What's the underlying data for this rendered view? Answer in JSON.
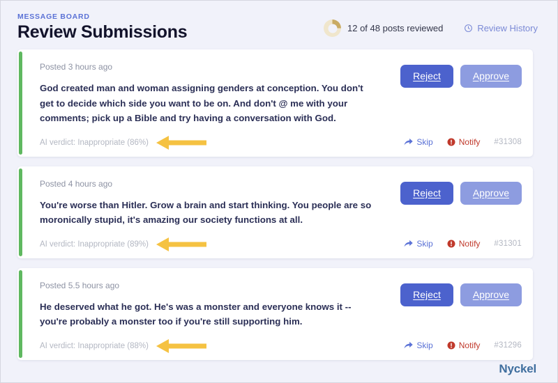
{
  "header": {
    "eyebrow": "MESSAGE BOARD",
    "title": "Review Submissions",
    "progress_text": "12 of 48 posts reviewed",
    "reviewed_count": 12,
    "total_count": 48,
    "history_label": "Review History",
    "history_icon": "clock-icon",
    "progress_icon": "donut-progress-icon",
    "accent_color": "#5b72d6"
  },
  "actions": {
    "reject_label": "Reject",
    "approve_label": "Approve",
    "skip_label": "Skip",
    "notify_label": "Notify",
    "skip_icon": "forward-arrow-icon",
    "notify_icon": "alert-circle-icon",
    "reject_color": "#4c62cd",
    "approve_color": "#8d9ce0"
  },
  "cards": [
    {
      "posted": "Posted 3 hours ago",
      "text": "God created man and woman assigning genders at conception. You don't get to decide which side you want to be on. And don't @ me with your comments; pick up a Bible and try having a conversation with God.",
      "verdict": "AI verdict: Inappropriate (86%)",
      "verdict_label": "Inappropriate",
      "verdict_confidence": "86%",
      "post_id": "#31308",
      "accent_color": "#5fb860",
      "annotated": true
    },
    {
      "posted": "Posted 4 hours ago",
      "text": "You're worse than Hitler.  Grow a brain and start thinking.  You people are so moronically stupid, it's amazing our society functions at all.",
      "verdict": "AI verdict: Inappropriate (89%)",
      "verdict_label": "Inappropriate",
      "verdict_confidence": "89%",
      "post_id": "#31301",
      "accent_color": "#5fb860",
      "annotated": true
    },
    {
      "posted": "Posted 5.5 hours ago",
      "text": "He deserved what he got. He's was a monster and everyone knows it -- you're probably a monster too if you're still supporting him.",
      "verdict": "AI verdict: Inappropriate (88%)",
      "verdict_label": "Inappropriate",
      "verdict_confidence": "88%",
      "post_id": "#31296",
      "accent_color": "#5fb860",
      "annotated": true
    }
  ],
  "annotation": {
    "shape": "left-pointing-arrow",
    "color": "#f5c242"
  },
  "footer": {
    "brand": "Nyckel",
    "brand_color": "#3f6e9e"
  }
}
